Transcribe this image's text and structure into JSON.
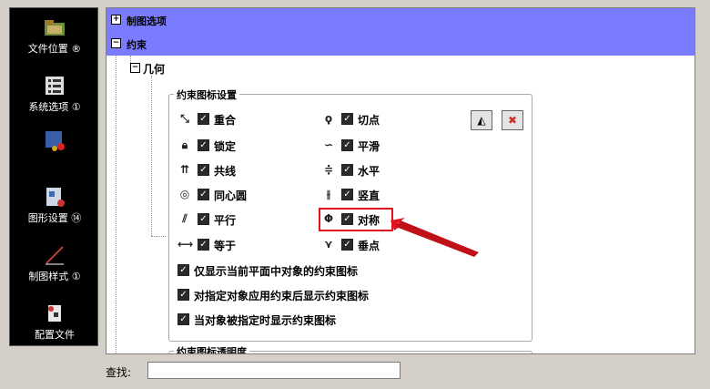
{
  "left_nav": [
    {
      "label": "文件位置 ®",
      "icon": "folder-icon"
    },
    {
      "label": "系统选项 ①",
      "icon": "system-options-icon"
    },
    {
      "label": "",
      "icon": "display-colors-icon"
    },
    {
      "label": "图形设置 ⑭",
      "icon": "graphics-settings-icon"
    },
    {
      "label": "制图样式 ①",
      "icon": "drafting-style-icon"
    },
    {
      "label": "配置文件",
      "icon": "profile-icon"
    }
  ],
  "tree": {
    "header1": "制图选项",
    "header2": "约束",
    "node": "几何",
    "group_title": "约束图标设置",
    "options_left": [
      {
        "label": "重合",
        "icon": "coincident-icon",
        "checked": true
      },
      {
        "label": "锁定",
        "icon": "lock-icon",
        "checked": true
      },
      {
        "label": "共线",
        "icon": "collinear-icon",
        "checked": true
      },
      {
        "label": "同心圆",
        "icon": "concentric-icon",
        "checked": true
      },
      {
        "label": "平行",
        "icon": "parallel-icon",
        "checked": true
      },
      {
        "label": "等于",
        "icon": "equal-icon",
        "checked": true
      }
    ],
    "options_right": [
      {
        "label": "切点",
        "icon": "tangent-icon",
        "checked": true
      },
      {
        "label": "平滑",
        "icon": "smooth-icon",
        "checked": true
      },
      {
        "label": "水平",
        "icon": "horizontal-icon",
        "checked": true
      },
      {
        "label": "竖直",
        "icon": "vertical-icon",
        "checked": true
      },
      {
        "label": "对称",
        "icon": "symmetric-icon",
        "checked": true
      },
      {
        "label": "垂点",
        "icon": "perpendicular-icon",
        "checked": true
      }
    ],
    "extra_options": [
      {
        "label": "仅显示当前平面中对象的约束图标",
        "checked": true
      },
      {
        "label": "对指定对象应用约束后显示约束图标",
        "checked": true
      },
      {
        "label": "当对象被指定时显示约束图标",
        "checked": true
      }
    ],
    "group2_title": "约束图标透明度"
  },
  "search": {
    "label": "查找:",
    "value": ""
  },
  "colors": {
    "header_bg": "#7b7bff",
    "highlight": "#e0141d"
  }
}
